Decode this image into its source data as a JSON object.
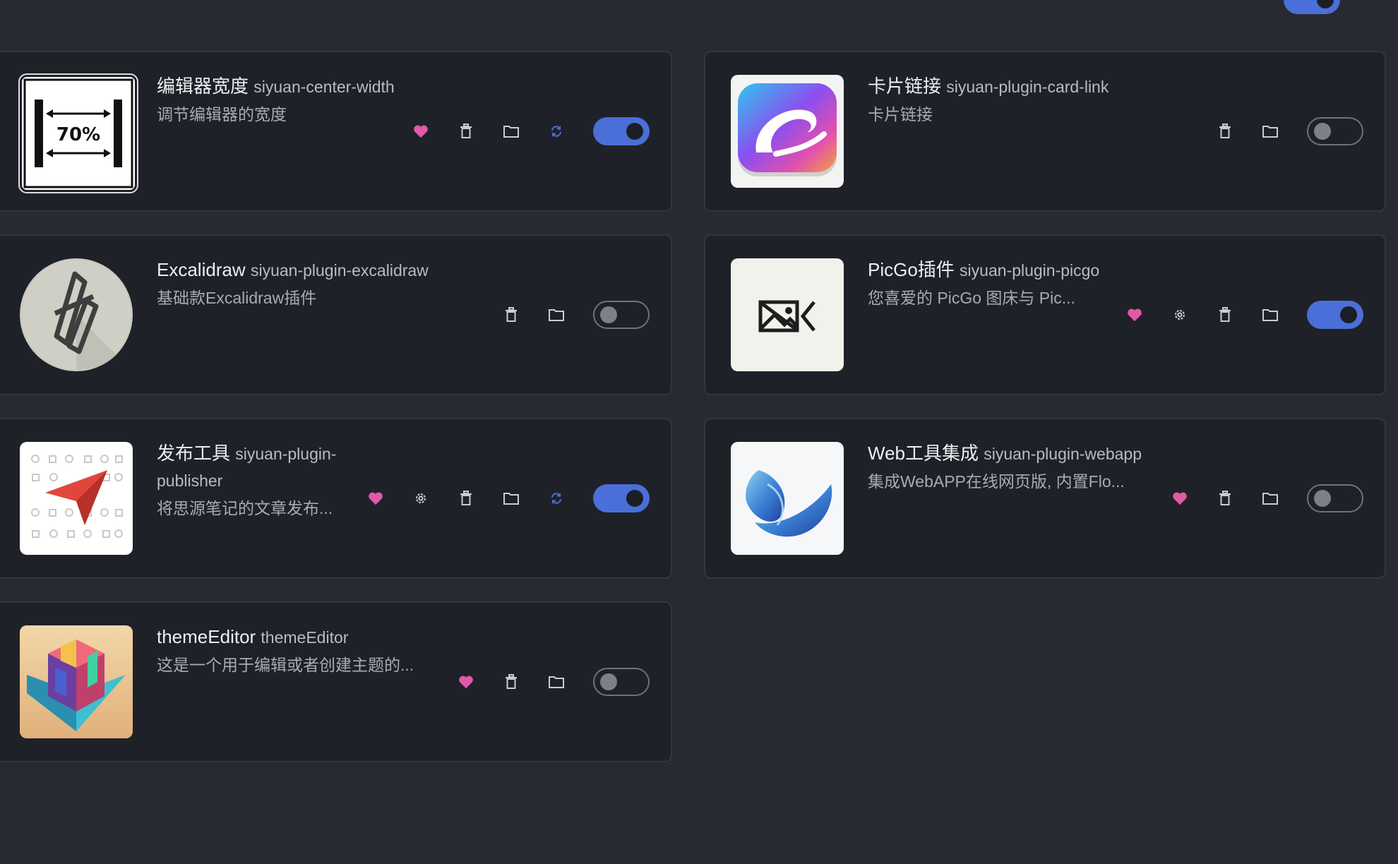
{
  "colors": {
    "accent": "#4a6fd8",
    "heart": "#e05aa8",
    "update": "#4a6fd8",
    "card_bg": "#1f2128",
    "page_bg": "#282a31"
  },
  "plugins": [
    {
      "title": "编辑器宽度",
      "package": "siyuan-center-width",
      "desc": "调节编辑器的宽度",
      "icon_text": "70%",
      "enabled": true,
      "actions": [
        "heart-icon",
        "trash-icon",
        "folder-icon",
        "update-icon"
      ]
    },
    {
      "title": "卡片链接",
      "package": "siyuan-plugin-card-link",
      "desc": "卡片链接",
      "enabled": false,
      "actions": [
        "trash-icon",
        "folder-icon"
      ]
    },
    {
      "title": "Excalidraw",
      "package": "siyuan-plugin-excalidraw",
      "desc": "基础款Excalidraw插件",
      "enabled": false,
      "actions": [
        "trash-icon",
        "folder-icon"
      ]
    },
    {
      "title": "PicGo插件",
      "package": "siyuan-plugin-picgo",
      "desc": "您喜爱的 PicGo 图床与 Pic...",
      "enabled": true,
      "actions": [
        "heart-icon",
        "gear-icon",
        "trash-icon",
        "folder-icon"
      ]
    },
    {
      "title": "发布工具",
      "package": "siyuan-plugin-publisher",
      "desc": "将思源笔记的文章发布...",
      "enabled": true,
      "actions": [
        "heart-icon",
        "gear-icon",
        "trash-icon",
        "folder-icon",
        "update-icon"
      ]
    },
    {
      "title": "Web工具集成",
      "package": "siyuan-plugin-webapp",
      "desc": "集成WebAPP在线网页版, 内置Flo...",
      "enabled": false,
      "actions": [
        "heart-icon",
        "trash-icon",
        "folder-icon"
      ]
    },
    {
      "title": "themeEditor",
      "package": "themeEditor",
      "desc": "这是一个用于编辑或者创建主题的...",
      "enabled": false,
      "actions": [
        "heart-icon",
        "trash-icon",
        "folder-icon"
      ]
    }
  ],
  "top_toggle_enabled": true
}
